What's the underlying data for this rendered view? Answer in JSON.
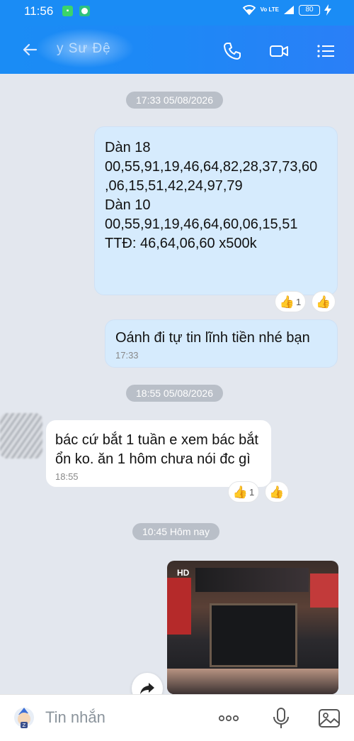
{
  "status_bar": {
    "time": "11:56",
    "app_icon_1": "wallet-app-icon",
    "app_icon_2": "chat-app-icon",
    "network": "Vo LTE",
    "battery": "80"
  },
  "header": {
    "contact_name": "y Sư Đệ",
    "icons": [
      "back-arrow-icon",
      "phone-icon",
      "video-call-icon",
      "menu-list-icon"
    ]
  },
  "messages": {
    "date_1": "17:33 05/08/2026",
    "msg1": {
      "lines": [
        "Dàn 18",
        "00,55,91,19,46,64,82,28,37,73,60",
        ",06,15,51,42,24,97,79",
        "",
        "Dàn 10",
        "00,55,91,19,46,64,60,06,15,51",
        "",
        "TTĐ: 46,64,06,60 x500k"
      ],
      "reaction_count": "1"
    },
    "msg2": {
      "text": "Oánh đi tự tin lĩnh tiền nhé bạn",
      "time": "17:33"
    },
    "date_2": "18:55 05/08/2026",
    "msg3": {
      "lines": [
        "bác cứ bắt 1 tuần e xem bác bắt",
        "ổn ko. ăn 1 hôm chưa nói đc gì"
      ],
      "time": "18:55",
      "reaction_count": "1"
    },
    "date_3": "10:45 Hôm nay",
    "photo": {
      "badge": "HD"
    }
  },
  "input_bar": {
    "placeholder": "Tin nhắn",
    "icons": [
      "sticker-icon",
      "more-options-icon",
      "microphone-icon",
      "gallery-icon"
    ]
  },
  "colors": {
    "header_blue": "#1a8cf5",
    "bubble_out": "#d6ebfd",
    "bubble_in": "#ffffff",
    "chat_bg": "#e3e7ee"
  }
}
